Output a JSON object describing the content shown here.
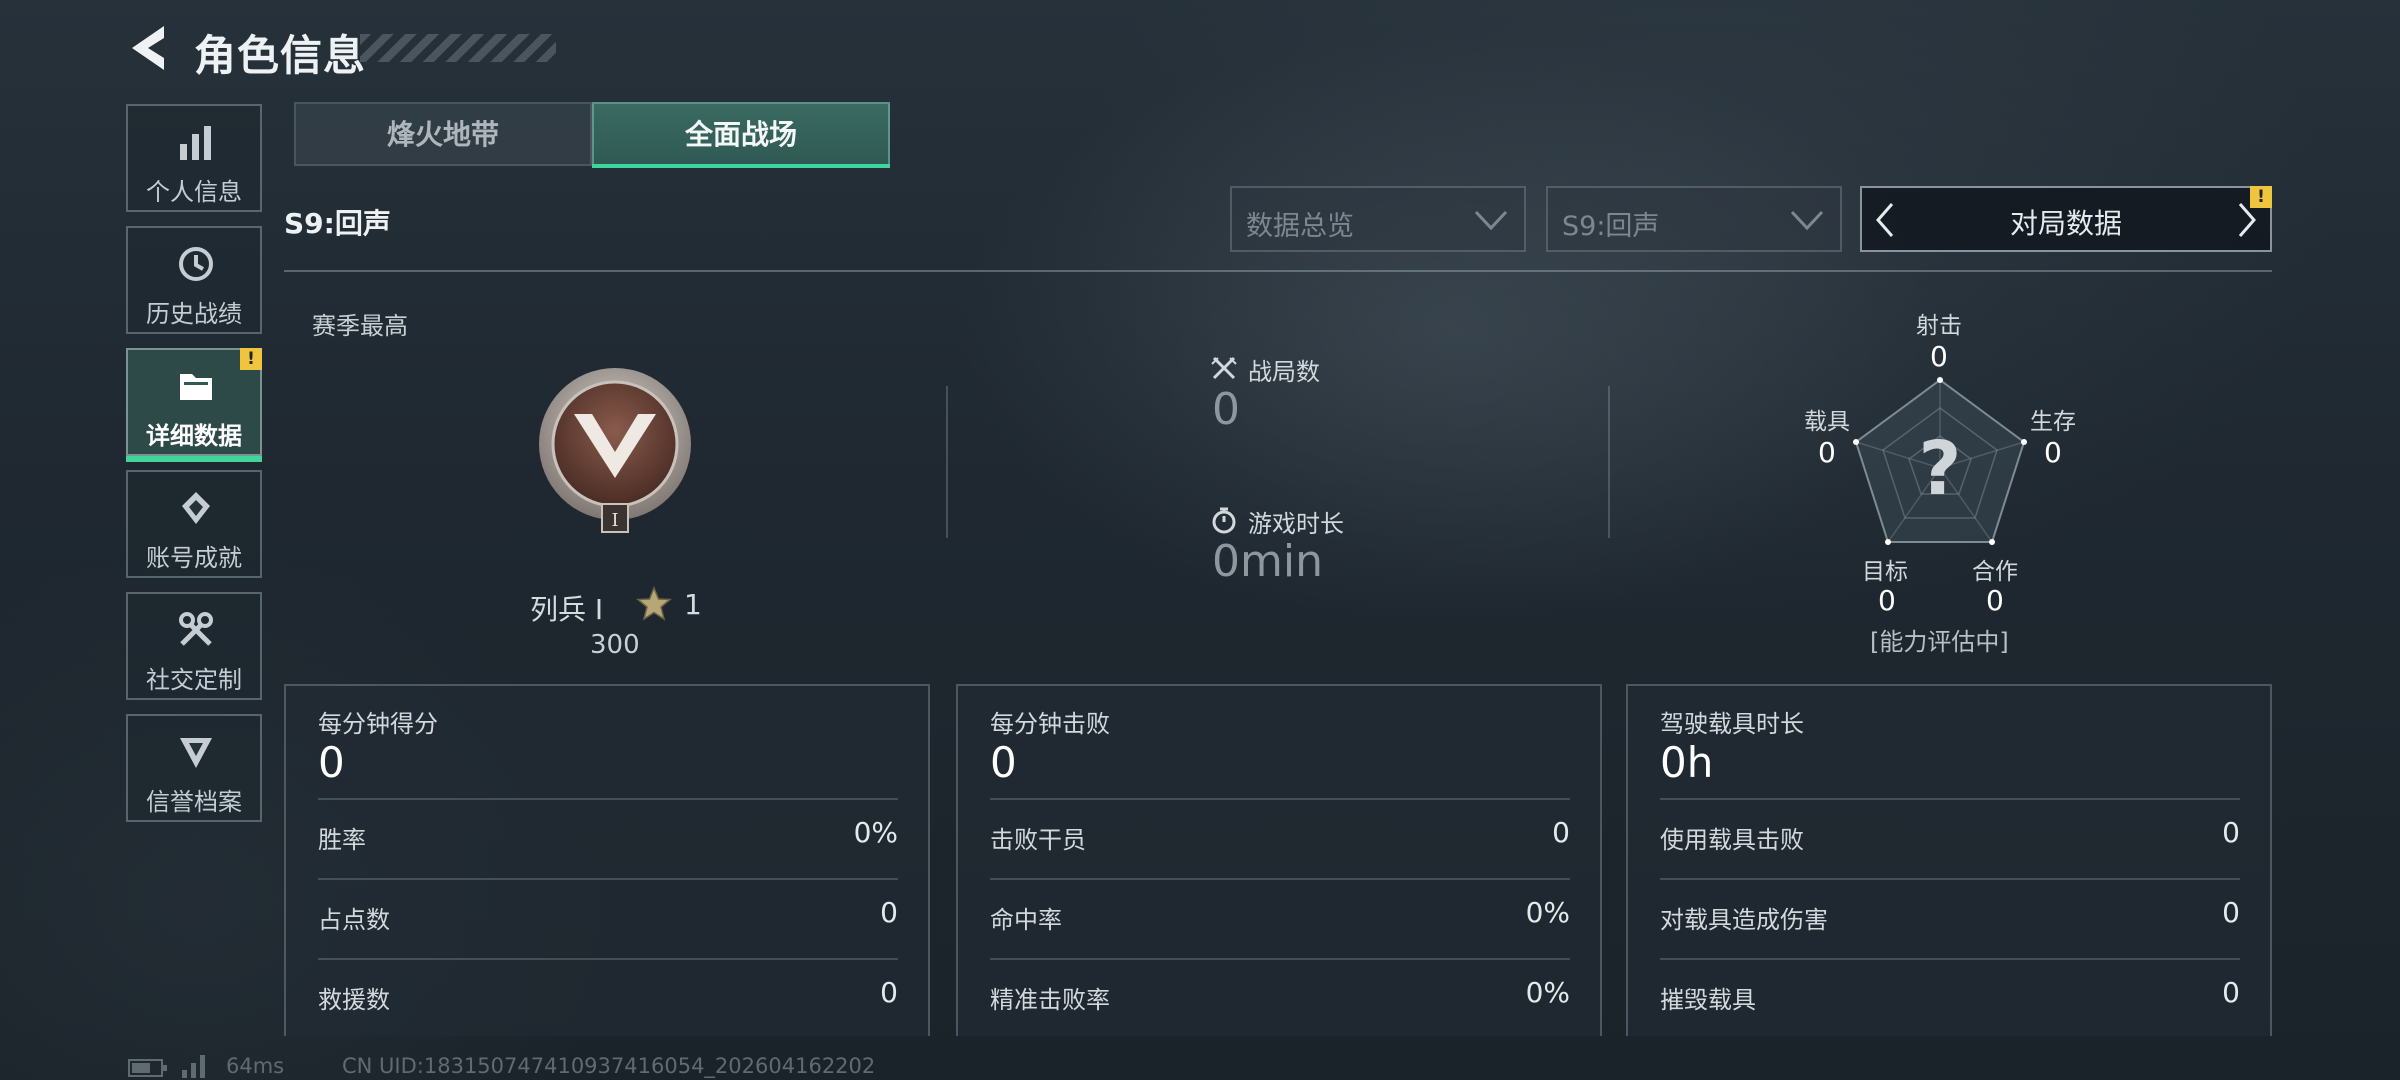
{
  "header": {
    "title": "角色信息"
  },
  "sidebar": {
    "items": [
      {
        "label": "个人信息",
        "icon": "bar-chart-icon"
      },
      {
        "label": "历史战绩",
        "icon": "history-clock-icon"
      },
      {
        "label": "详细数据",
        "icon": "folder-icon",
        "active": true,
        "badge": "!"
      },
      {
        "label": "账号成就",
        "icon": "achievement-icon"
      },
      {
        "label": "社交定制",
        "icon": "wrench-icon"
      },
      {
        "label": "信誉档案",
        "icon": "credit-shield-icon"
      }
    ]
  },
  "tabs": [
    {
      "label": "烽火地带",
      "active": false
    },
    {
      "label": "全面战场",
      "active": true
    }
  ],
  "toolbar": {
    "season_label": "S9:回声",
    "dropdown_view": "数据总览",
    "dropdown_season": "S9:回声",
    "match_selector": "对局数据",
    "match_badge": "!"
  },
  "season_best": {
    "label": "赛季最高",
    "emblem_numeral": "I",
    "rank_name": "列兵 I",
    "stars": "1",
    "points": "300"
  },
  "summary": {
    "matches_label": "战局数",
    "matches_value": "0",
    "playtime_label": "游戏时长",
    "playtime_value": "0min"
  },
  "radar": {
    "unknown_mark": "?",
    "axes": [
      {
        "label": "射击",
        "value": "0"
      },
      {
        "label": "生存",
        "value": "0"
      },
      {
        "label": "合作",
        "value": "0"
      },
      {
        "label": "目标",
        "value": "0"
      },
      {
        "label": "载具",
        "value": "0"
      }
    ],
    "note": "[能力评估中]"
  },
  "cards": [
    {
      "title": "每分钟得分",
      "value": "0",
      "rows": [
        {
          "label": "胜率",
          "value": "0%"
        },
        {
          "label": "占点数",
          "value": "0"
        },
        {
          "label": "救援数",
          "value": "0"
        }
      ]
    },
    {
      "title": "每分钟击败",
      "value": "0",
      "rows": [
        {
          "label": "击败干员",
          "value": "0"
        },
        {
          "label": "命中率",
          "value": "0%"
        },
        {
          "label": "精准击败率",
          "value": "0%"
        }
      ]
    },
    {
      "title": "驾驶载具时长",
      "value": "0h",
      "rows": [
        {
          "label": "使用载具击败",
          "value": "0"
        },
        {
          "label": "对载具造成伤害",
          "value": "0"
        },
        {
          "label": "摧毁载具",
          "value": "0"
        }
      ]
    }
  ],
  "footer": {
    "ping": "64ms",
    "uid": "CN UID:1831507474109374160​54_202604162202"
  },
  "colors": {
    "accent": "#3fd59d",
    "badge": "#f0c53e",
    "active_tab": "#2f5a53"
  }
}
